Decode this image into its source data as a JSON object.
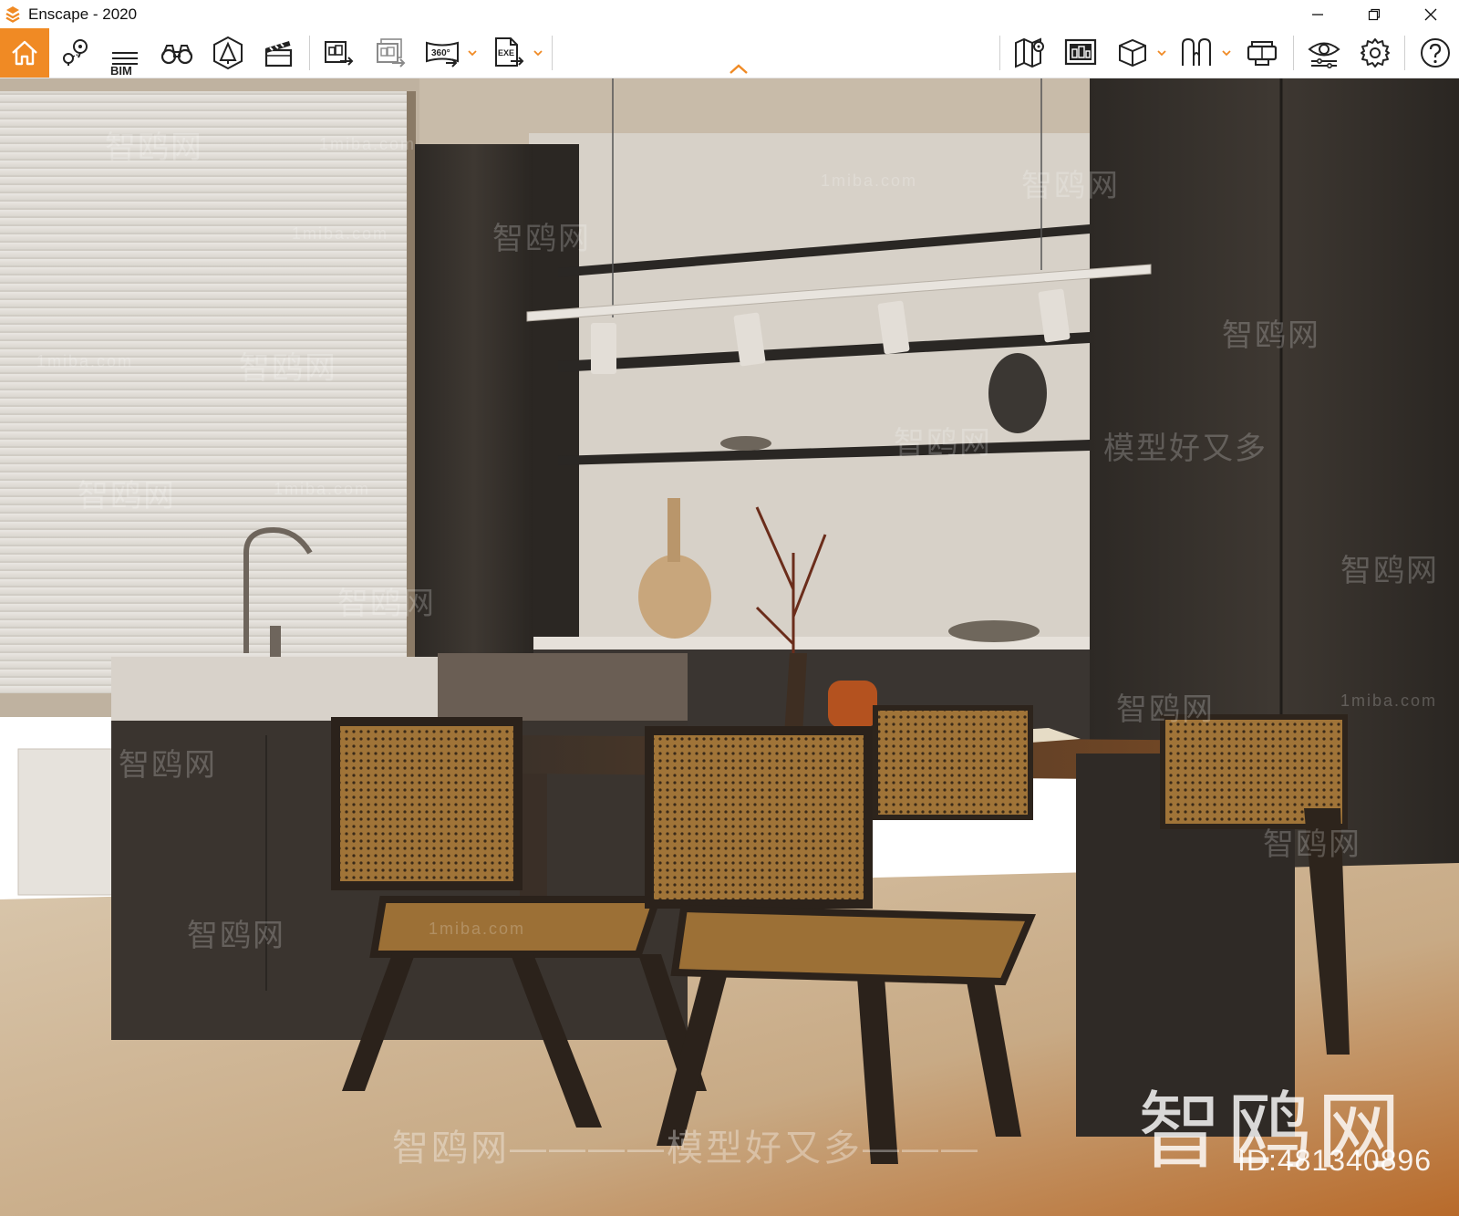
{
  "window": {
    "title": "Enscape - 2020",
    "controls": [
      "minimize-icon",
      "restore-icon",
      "close-icon"
    ]
  },
  "toolbar": {
    "accent_color": "#f08a24",
    "left_group": [
      {
        "name": "home",
        "icon": "home-icon"
      },
      {
        "name": "views",
        "icon": "map-pin-icon"
      },
      {
        "name": "bim",
        "icon": "bim-list-icon",
        "label": "BIM"
      },
      {
        "name": "walk-mode",
        "icon": "binoculars-icon"
      },
      {
        "name": "atmosphere",
        "icon": "asset-library-icon"
      },
      {
        "name": "video-editor",
        "icon": "clapperboard-icon"
      }
    ],
    "export_group": [
      {
        "name": "render-image",
        "icon": "screenshot-export-icon"
      },
      {
        "name": "batch-render",
        "icon": "batch-export-icon"
      },
      {
        "name": "panorama",
        "icon": "panorama-360-icon",
        "label": "360°",
        "has_dropdown": true
      },
      {
        "name": "exe-export",
        "icon": "exe-export-icon",
        "label": "EXE",
        "has_dropdown": true
      }
    ],
    "right_group": [
      {
        "name": "map",
        "icon": "map-icon"
      },
      {
        "name": "view-management",
        "icon": "image-gallery-icon"
      },
      {
        "name": "orthographic",
        "icon": "cube-icon",
        "has_dropdown": true
      },
      {
        "name": "asset-library",
        "icon": "asset-shapes-icon",
        "has_dropdown": true
      },
      {
        "name": "vr-headset",
        "icon": "vr-headset-icon"
      },
      {
        "name": "visual-settings",
        "icon": "eye-settings-icon"
      },
      {
        "name": "general-settings",
        "icon": "gear-icon"
      },
      {
        "name": "help",
        "icon": "help-icon"
      }
    ],
    "collapse_icon": "chevron-up-icon"
  },
  "viewport": {
    "watermarks": {
      "brand": "智鸥网",
      "site": "1miba.com",
      "slogan": "智鸥网————模型好又多———",
      "slogan_short": "模型好又多",
      "id": "ID:481340896"
    }
  }
}
